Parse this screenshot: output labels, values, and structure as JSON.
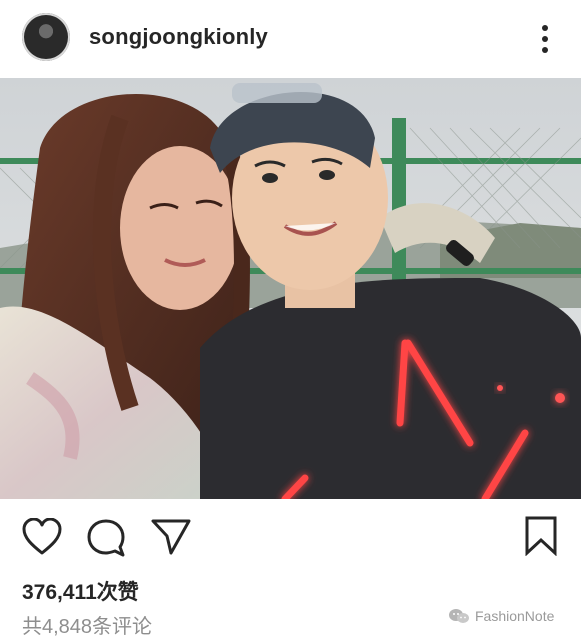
{
  "header": {
    "username": "songjoongkionly",
    "more_icon": "more-vertical-icon"
  },
  "post": {
    "image_description": "",
    "actions": {
      "like_icon": "heart-icon",
      "comment_icon": "comment-bubble-icon",
      "share_icon": "send-icon",
      "save_icon": "bookmark-icon"
    },
    "likes_text": "376,411次赞",
    "comments_text": "共4,848条评论"
  },
  "watermark": {
    "text": "FashionNote"
  },
  "colors": {
    "text_primary": "#262626",
    "text_secondary": "#8e8e8e",
    "accent_neon": "#ff3b3b"
  }
}
